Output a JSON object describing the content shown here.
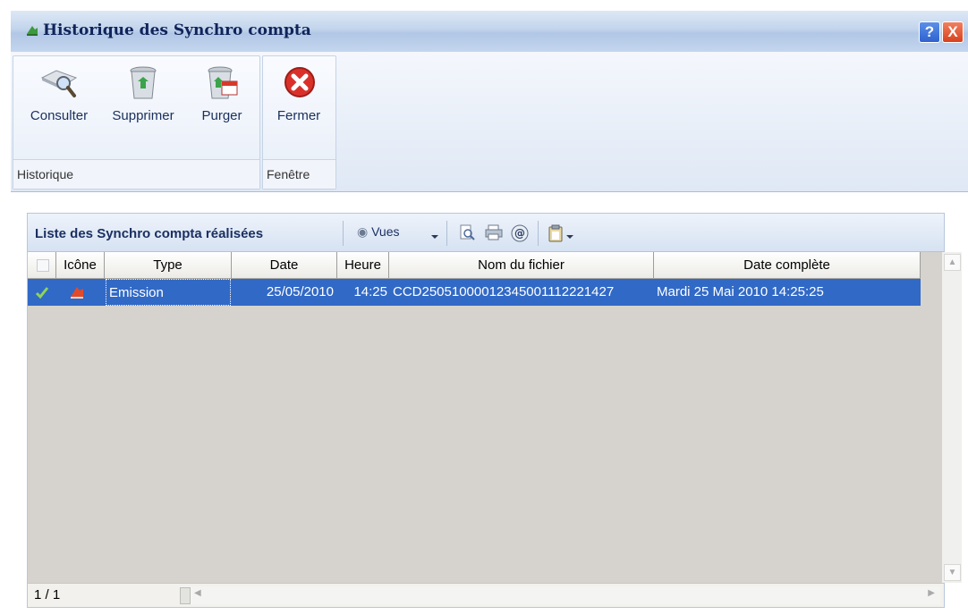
{
  "window": {
    "title": "Historique des Synchro compta",
    "help_label": "?",
    "close_label": "X"
  },
  "ribbon": {
    "groups": [
      {
        "label": "Historique",
        "buttons": [
          {
            "label": "Consulter",
            "icon": "magnifier-book-icon"
          },
          {
            "label": "Supprimer",
            "icon": "recycle-bin-icon"
          },
          {
            "label": "Purger",
            "icon": "recycle-bin-calendar-icon"
          }
        ]
      },
      {
        "label": "Fenêtre",
        "buttons": [
          {
            "label": "Fermer",
            "icon": "close-circle-icon"
          }
        ]
      }
    ]
  },
  "panel": {
    "title": "Liste des Synchro compta réalisées",
    "vues_label": "Vues",
    "columns": [
      "Icône",
      "Type",
      "Date",
      "Heure",
      "Nom du fichier",
      "Date complète"
    ],
    "rows": [
      {
        "type": "Emission",
        "date": "25/05/2010",
        "heure": "14:25",
        "fichier": "CCD25051000012345001112221427",
        "date_complete": "Mardi 25 Mai 2010 14:25:25"
      }
    ],
    "status": "1 / 1"
  },
  "colors": {
    "selection": "#3169c6",
    "title_text": "#10245a",
    "empty_area": "#d6d3ce"
  }
}
